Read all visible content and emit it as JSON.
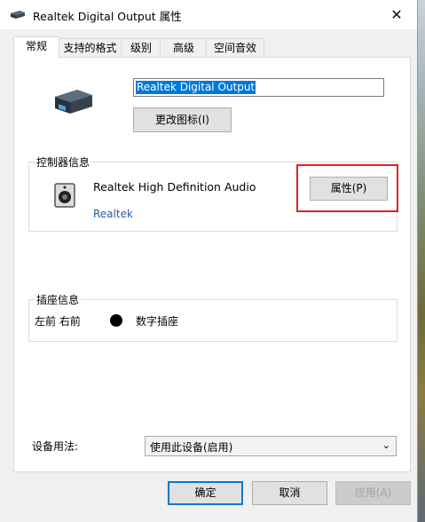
{
  "window": {
    "title": "Realtek Digital Output 属性",
    "close_glyph": "✕"
  },
  "tabs": [
    {
      "label": "常规",
      "active": true
    },
    {
      "label": "支持的格式",
      "active": false
    },
    {
      "label": "级别",
      "active": false
    },
    {
      "label": "高级",
      "active": false
    },
    {
      "label": "空间音效",
      "active": false
    }
  ],
  "general": {
    "device_name_value": "Realtek Digital Output",
    "change_icon_label": "更改图标(I)",
    "controller": {
      "group_label": "控制器信息",
      "name": "Realtek High Definition Audio",
      "vendor": "Realtek",
      "properties_label": "属性(P)"
    },
    "jack": {
      "group_label": "插座信息",
      "location": "左前 右前",
      "type": "数字插座"
    },
    "usage": {
      "label": "设备用法:",
      "selected": "使用此设备(启用)"
    }
  },
  "footer": {
    "ok_label": "确定",
    "cancel_label": "取消",
    "apply_label": "应用(A)",
    "apply_enabled": false
  },
  "colors": {
    "accent": "#0078d7",
    "highlight_box": "#d9252a",
    "link": "#2b5aa8"
  }
}
